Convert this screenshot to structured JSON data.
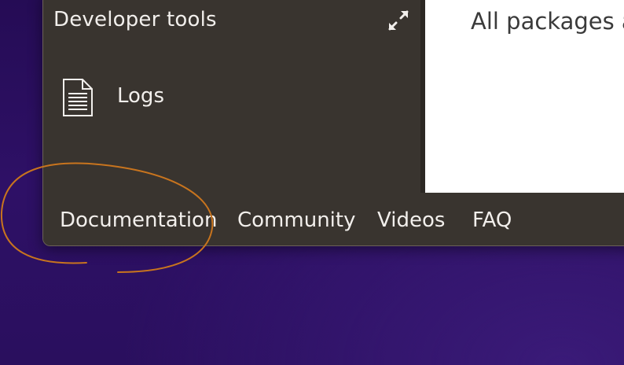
{
  "dev_tools": {
    "title": "Developer tools",
    "expand_icon": "expand-arrows-icon",
    "items": [
      {
        "label": "Logs",
        "icon": "document-icon"
      }
    ]
  },
  "content": {
    "title": "All packages a"
  },
  "footer": {
    "links": [
      {
        "label": "Documentation"
      },
      {
        "label": "Community"
      },
      {
        "label": "Videos"
      },
      {
        "label": "FAQ"
      }
    ]
  },
  "colors": {
    "panel_bg": "#39342f",
    "panel_text": "#f2efec",
    "annotation_stroke": "#c8741e",
    "desktop_bg": "#2e1066"
  }
}
